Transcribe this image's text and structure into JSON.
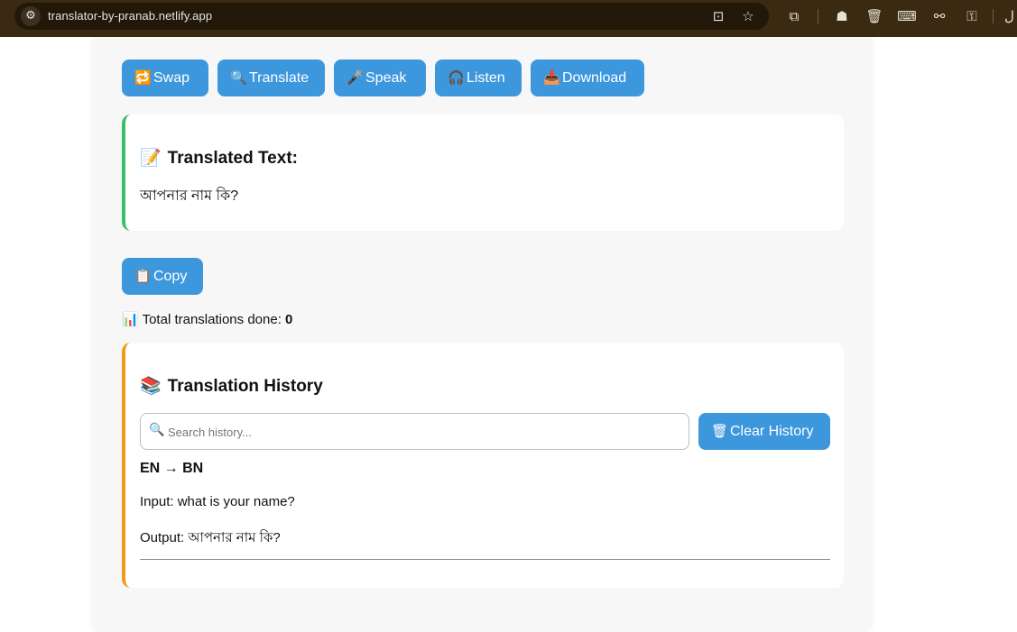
{
  "browser": {
    "url": "translator-by-pranab.netlify.app",
    "edge_glyph": "ل"
  },
  "actions": {
    "swap": "Swap",
    "translate": "Translate",
    "speak": "Speak",
    "listen": "Listen",
    "download": "Download"
  },
  "translated": {
    "title": "Translated Text:",
    "text": "আপনার নাম কি?"
  },
  "copy_label": "Copy",
  "stats": {
    "label": "Total translations done:",
    "count": "0"
  },
  "history": {
    "title": "Translation History",
    "search_placeholder": "Search history...",
    "clear_label": "Clear History",
    "entries": [
      {
        "pair": "EN → BN",
        "input": "Input: what is your name?",
        "output": "Output: আপনার নাম কি?"
      }
    ]
  },
  "icons": {
    "site_settings": "tune-icon",
    "install": "install-app-icon",
    "bookmark": "star-icon",
    "extensions": "puzzle-icon",
    "swap": "swap-arrows-icon",
    "translate": "magnifier-icon",
    "speak": "microphone-icon",
    "listen": "headphones-icon",
    "download": "download-tray-icon",
    "translated": "memo-icon",
    "copy": "clipboard-icon",
    "stats": "bar-chart-icon",
    "history": "books-icon",
    "search": "search-icon",
    "clear": "wastebasket-icon"
  },
  "colors": {
    "accent": "#3d97dd",
    "translated_border": "#3bbf6a",
    "history_border": "#f09a17",
    "chrome": "#3a2a12"
  }
}
